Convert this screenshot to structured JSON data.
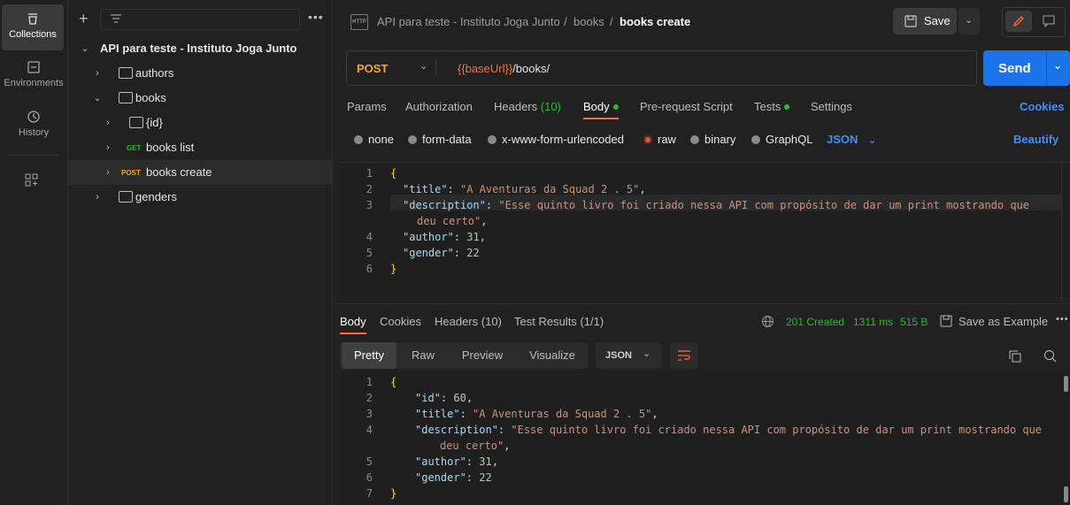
{
  "rail": {
    "items": [
      {
        "label": "Collections"
      },
      {
        "label": "Environments"
      },
      {
        "label": "History"
      }
    ]
  },
  "sidebar": {
    "collection_name": "API para teste - Instituto Joga Junto",
    "tree": [
      {
        "label": "authors"
      },
      {
        "label": "books"
      },
      {
        "label": "{id}"
      },
      {
        "label": "books list",
        "method": "GET"
      },
      {
        "label": "books create",
        "method": "POST"
      },
      {
        "label": "genders"
      }
    ]
  },
  "header": {
    "crumb_collection": "API para teste - Instituto Joga Junto",
    "crumb_sep1": "/",
    "crumb_folder": "books",
    "crumb_sep2": "/",
    "crumb_request": "books create",
    "save_label": "Save",
    "http_badge": "HTTP"
  },
  "request": {
    "method": "POST",
    "url_var": "{{baseUrl}}",
    "url_path": "/books/",
    "send_label": "Send",
    "tabs": [
      "Params",
      "Authorization",
      "Headers",
      "Body",
      "Pre-request Script",
      "Tests",
      "Settings"
    ],
    "headers_count": "(10)",
    "cookies_label": "Cookies",
    "body_modes": [
      "none",
      "form-data",
      "x-www-form-urlencoded",
      "raw",
      "binary",
      "GraphQL"
    ],
    "format": "JSON",
    "beautify_label": "Beautify",
    "body_lines": {
      "l1": "{",
      "l2_key": "\"title\"",
      "l2_val": "\"A Aventuras da Squad 2 . 5\"",
      "l3_key": "\"description\"",
      "l3_val_a": "\"Esse quinto livro foi criado nessa API com propósito de dar um print mostrando que",
      "l3_val_b": "deu certo\"",
      "l4_key": "\"author\"",
      "l4_val": "31",
      "l5_key": "\"gender\"",
      "l5_val": "22",
      "l6": "}"
    }
  },
  "response": {
    "tabs": [
      "Body",
      "Cookies",
      "Headers",
      "Test Results"
    ],
    "headers_count": "(10)",
    "test_count": "(1/1)",
    "status": "201 Created",
    "time": "1311 ms",
    "size": "515 B",
    "save_example": "Save as Example",
    "views": [
      "Pretty",
      "Raw",
      "Preview",
      "Visualize"
    ],
    "format": "JSON",
    "body_lines": {
      "l1": "{",
      "l2_key": "\"id\"",
      "l2_val": "60",
      "l3_key": "\"title\"",
      "l3_val": "\"A Aventuras da Squad 2 . 5\"",
      "l4_key": "\"description\"",
      "l4_val_a": "\"Esse quinto livro foi criado nessa API com propósito de dar um print mostrando que",
      "l4_val_b": "deu certo\"",
      "l5_key": "\"author\"",
      "l5_val": "31",
      "l6_key": "\"gender\"",
      "l6_val": "22",
      "l7": "}"
    }
  },
  "colors": {
    "accent": "#1a73e8",
    "post": "#f5a623",
    "get": "#2eb82e",
    "status_ok": "#2eb82e",
    "active_tab": "#ff6c37"
  }
}
